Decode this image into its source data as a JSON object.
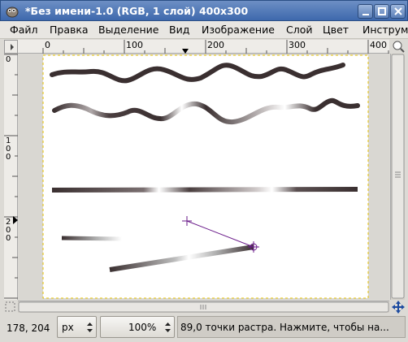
{
  "window": {
    "title": "*Без имени-1.0 (RGB, 1 слой) 400x300",
    "buttons": [
      "minimize",
      "maximize",
      "close"
    ]
  },
  "menubar": {
    "items": [
      {
        "label": "Файл"
      },
      {
        "label": "Правка"
      },
      {
        "label": "Выделение"
      },
      {
        "label": "Вид"
      },
      {
        "label": "Изображение"
      },
      {
        "label": "Слой"
      },
      {
        "label": "Цвет"
      },
      {
        "label": "Инструм"
      }
    ]
  },
  "rulers": {
    "horizontal_labels": [
      "0",
      "100",
      "200",
      "300",
      "400"
    ],
    "vertical_labels": [
      "0",
      "100",
      "200"
    ]
  },
  "statusbar": {
    "coords": "178, 204",
    "unit": "px",
    "zoom": "100%",
    "message": "89,0 точки растра.  Нажмите, чтобы на..."
  },
  "colors": {
    "titlebar": "#4a74b5",
    "stroke": "#3a2f30",
    "guide_line": "#6a1b8a",
    "canvas_border": "#e6c200"
  },
  "icons": {
    "app": "gimp-icon",
    "minimize": "minimize-icon",
    "maximize": "maximize-icon",
    "close": "close-icon",
    "navigate": "navigate-icon"
  }
}
